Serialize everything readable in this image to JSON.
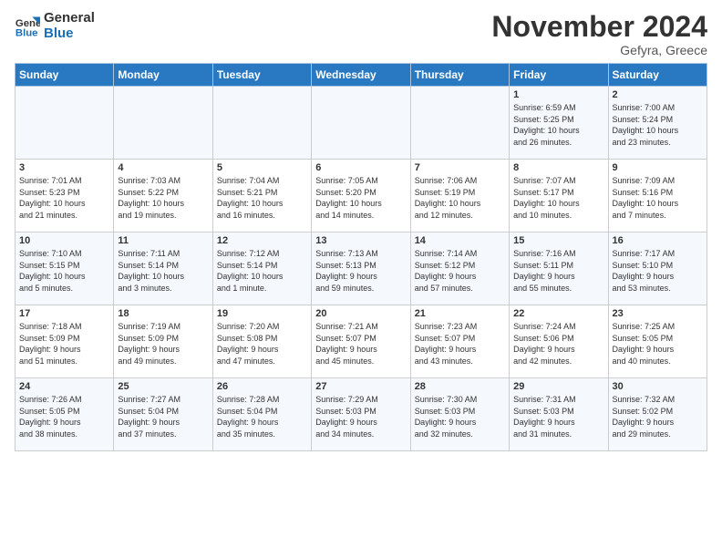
{
  "logo": {
    "line1": "General",
    "line2": "Blue"
  },
  "title": "November 2024",
  "location": "Gefyra, Greece",
  "days_of_week": [
    "Sunday",
    "Monday",
    "Tuesday",
    "Wednesday",
    "Thursday",
    "Friday",
    "Saturday"
  ],
  "weeks": [
    [
      {
        "day": "",
        "info": ""
      },
      {
        "day": "",
        "info": ""
      },
      {
        "day": "",
        "info": ""
      },
      {
        "day": "",
        "info": ""
      },
      {
        "day": "",
        "info": ""
      },
      {
        "day": "1",
        "info": "Sunrise: 6:59 AM\nSunset: 5:25 PM\nDaylight: 10 hours\nand 26 minutes."
      },
      {
        "day": "2",
        "info": "Sunrise: 7:00 AM\nSunset: 5:24 PM\nDaylight: 10 hours\nand 23 minutes."
      }
    ],
    [
      {
        "day": "3",
        "info": "Sunrise: 7:01 AM\nSunset: 5:23 PM\nDaylight: 10 hours\nand 21 minutes."
      },
      {
        "day": "4",
        "info": "Sunrise: 7:03 AM\nSunset: 5:22 PM\nDaylight: 10 hours\nand 19 minutes."
      },
      {
        "day": "5",
        "info": "Sunrise: 7:04 AM\nSunset: 5:21 PM\nDaylight: 10 hours\nand 16 minutes."
      },
      {
        "day": "6",
        "info": "Sunrise: 7:05 AM\nSunset: 5:20 PM\nDaylight: 10 hours\nand 14 minutes."
      },
      {
        "day": "7",
        "info": "Sunrise: 7:06 AM\nSunset: 5:19 PM\nDaylight: 10 hours\nand 12 minutes."
      },
      {
        "day": "8",
        "info": "Sunrise: 7:07 AM\nSunset: 5:17 PM\nDaylight: 10 hours\nand 10 minutes."
      },
      {
        "day": "9",
        "info": "Sunrise: 7:09 AM\nSunset: 5:16 PM\nDaylight: 10 hours\nand 7 minutes."
      }
    ],
    [
      {
        "day": "10",
        "info": "Sunrise: 7:10 AM\nSunset: 5:15 PM\nDaylight: 10 hours\nand 5 minutes."
      },
      {
        "day": "11",
        "info": "Sunrise: 7:11 AM\nSunset: 5:14 PM\nDaylight: 10 hours\nand 3 minutes."
      },
      {
        "day": "12",
        "info": "Sunrise: 7:12 AM\nSunset: 5:14 PM\nDaylight: 10 hours\nand 1 minute."
      },
      {
        "day": "13",
        "info": "Sunrise: 7:13 AM\nSunset: 5:13 PM\nDaylight: 9 hours\nand 59 minutes."
      },
      {
        "day": "14",
        "info": "Sunrise: 7:14 AM\nSunset: 5:12 PM\nDaylight: 9 hours\nand 57 minutes."
      },
      {
        "day": "15",
        "info": "Sunrise: 7:16 AM\nSunset: 5:11 PM\nDaylight: 9 hours\nand 55 minutes."
      },
      {
        "day": "16",
        "info": "Sunrise: 7:17 AM\nSunset: 5:10 PM\nDaylight: 9 hours\nand 53 minutes."
      }
    ],
    [
      {
        "day": "17",
        "info": "Sunrise: 7:18 AM\nSunset: 5:09 PM\nDaylight: 9 hours\nand 51 minutes."
      },
      {
        "day": "18",
        "info": "Sunrise: 7:19 AM\nSunset: 5:09 PM\nDaylight: 9 hours\nand 49 minutes."
      },
      {
        "day": "19",
        "info": "Sunrise: 7:20 AM\nSunset: 5:08 PM\nDaylight: 9 hours\nand 47 minutes."
      },
      {
        "day": "20",
        "info": "Sunrise: 7:21 AM\nSunset: 5:07 PM\nDaylight: 9 hours\nand 45 minutes."
      },
      {
        "day": "21",
        "info": "Sunrise: 7:23 AM\nSunset: 5:07 PM\nDaylight: 9 hours\nand 43 minutes."
      },
      {
        "day": "22",
        "info": "Sunrise: 7:24 AM\nSunset: 5:06 PM\nDaylight: 9 hours\nand 42 minutes."
      },
      {
        "day": "23",
        "info": "Sunrise: 7:25 AM\nSunset: 5:05 PM\nDaylight: 9 hours\nand 40 minutes."
      }
    ],
    [
      {
        "day": "24",
        "info": "Sunrise: 7:26 AM\nSunset: 5:05 PM\nDaylight: 9 hours\nand 38 minutes."
      },
      {
        "day": "25",
        "info": "Sunrise: 7:27 AM\nSunset: 5:04 PM\nDaylight: 9 hours\nand 37 minutes."
      },
      {
        "day": "26",
        "info": "Sunrise: 7:28 AM\nSunset: 5:04 PM\nDaylight: 9 hours\nand 35 minutes."
      },
      {
        "day": "27",
        "info": "Sunrise: 7:29 AM\nSunset: 5:03 PM\nDaylight: 9 hours\nand 34 minutes."
      },
      {
        "day": "28",
        "info": "Sunrise: 7:30 AM\nSunset: 5:03 PM\nDaylight: 9 hours\nand 32 minutes."
      },
      {
        "day": "29",
        "info": "Sunrise: 7:31 AM\nSunset: 5:03 PM\nDaylight: 9 hours\nand 31 minutes."
      },
      {
        "day": "30",
        "info": "Sunrise: 7:32 AM\nSunset: 5:02 PM\nDaylight: 9 hours\nand 29 minutes."
      }
    ]
  ]
}
